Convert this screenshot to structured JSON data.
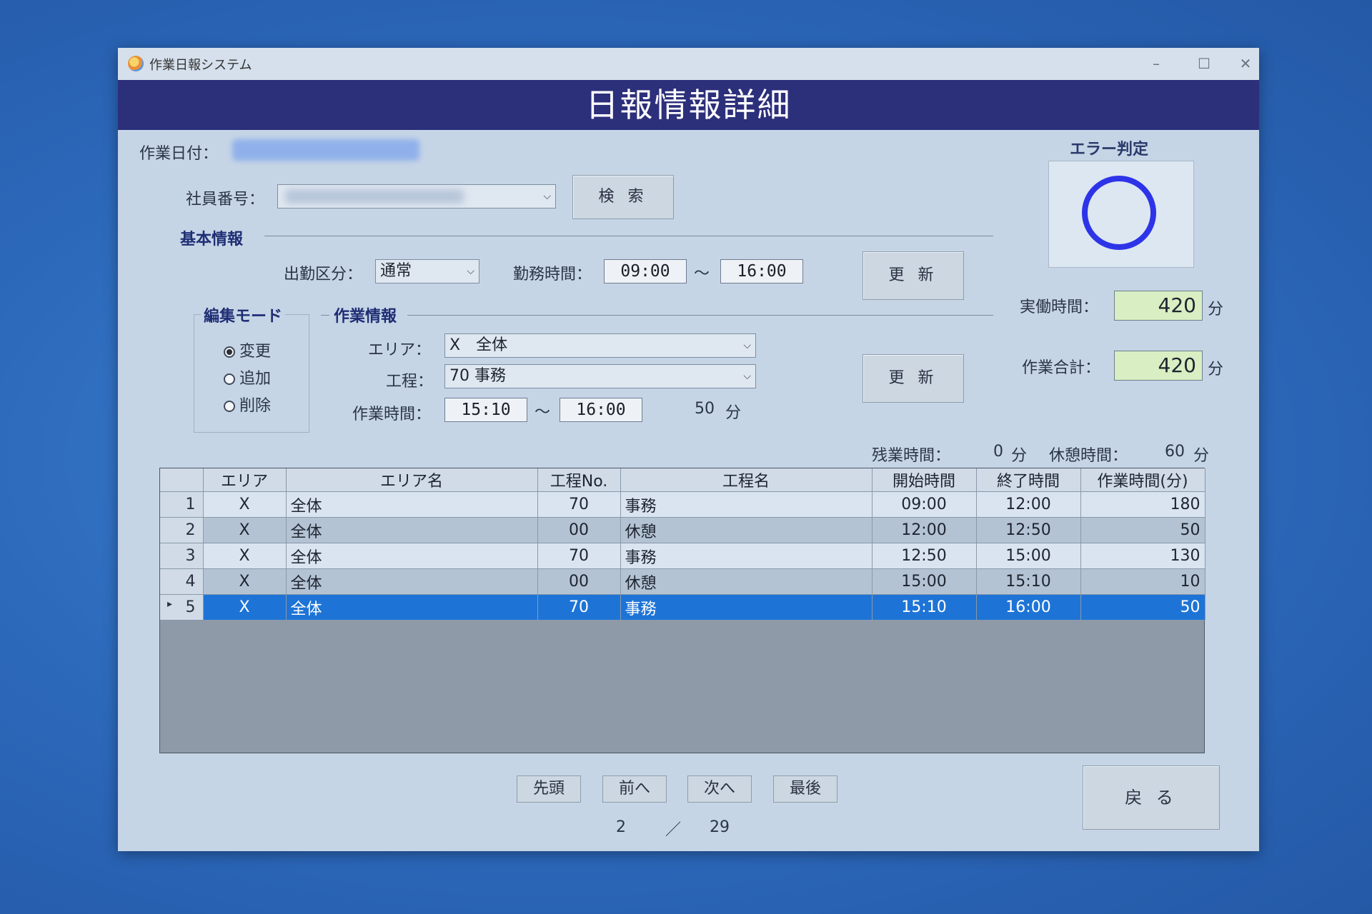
{
  "window": {
    "title": "作業日報システム",
    "minimize": "–",
    "maximize": "☐",
    "close": "✕"
  },
  "header": {
    "title": "日報情報詳細"
  },
  "top": {
    "date_label": "作業日付：",
    "employee_label": "社員番号：",
    "search_button": "検 索"
  },
  "basic": {
    "section_label": "基本情報",
    "attendance_label": "出勤区分：",
    "attendance_value": "通常",
    "work_hours_label": "勤務時間：",
    "start": "09:00",
    "tilde": "〜",
    "end": "16:00",
    "update_button": "更 新"
  },
  "edit_mode": {
    "label": "編集モード",
    "options": [
      "変更",
      "追加",
      "削除"
    ],
    "selected": "変更"
  },
  "work": {
    "section_label": "作業情報",
    "area_label": "エリア：",
    "area_value": "X　全体",
    "process_label": "工程：",
    "process_value": "70 事務",
    "time_label": "作業時間：",
    "start": "15:10",
    "tilde": "〜",
    "end": "16:00",
    "minutes": "50",
    "minutes_unit": "分",
    "update_button": "更 新"
  },
  "error": {
    "label": "エラー判定",
    "mark": "○"
  },
  "summary": {
    "actual_label": "実働時間：",
    "actual_value": "420",
    "actual_unit": "分",
    "total_label": "作業合計：",
    "total_value": "420",
    "total_unit": "分",
    "overtime_label": "残業時間：",
    "overtime_value": "0",
    "overtime_unit": "分",
    "break_label": "休憩時間：",
    "break_value": "60",
    "break_unit": "分"
  },
  "table": {
    "columns": [
      "エリア",
      "エリア名",
      "工程No.",
      "工程名",
      "開始時間",
      "終了時間",
      "作業時間(分)"
    ],
    "rows": [
      {
        "no": "1",
        "area": "X",
        "area_name": "全体",
        "proc_no": "70",
        "proc_name": "事務",
        "start": "09:00",
        "end": "12:00",
        "minutes": "180"
      },
      {
        "no": "2",
        "area": "X",
        "area_name": "全体",
        "proc_no": "00",
        "proc_name": "休憩",
        "start": "12:00",
        "end": "12:50",
        "minutes": "50"
      },
      {
        "no": "3",
        "area": "X",
        "area_name": "全体",
        "proc_no": "70",
        "proc_name": "事務",
        "start": "12:50",
        "end": "15:00",
        "minutes": "130"
      },
      {
        "no": "4",
        "area": "X",
        "area_name": "全体",
        "proc_no": "00",
        "proc_name": "休憩",
        "start": "15:00",
        "end": "15:10",
        "minutes": "10"
      },
      {
        "no": "5",
        "area": "X",
        "area_name": "全体",
        "proc_no": "70",
        "proc_name": "事務",
        "start": "15:10",
        "end": "16:00",
        "minutes": "50"
      }
    ],
    "selected_row": "5",
    "selected_marker": "▸"
  },
  "nav": {
    "first": "先頭",
    "prev": "前へ",
    "next": "次へ",
    "last": "最後",
    "current_page": "2",
    "separator": "／",
    "total_pages": "29"
  },
  "back_button": "戻 る"
}
